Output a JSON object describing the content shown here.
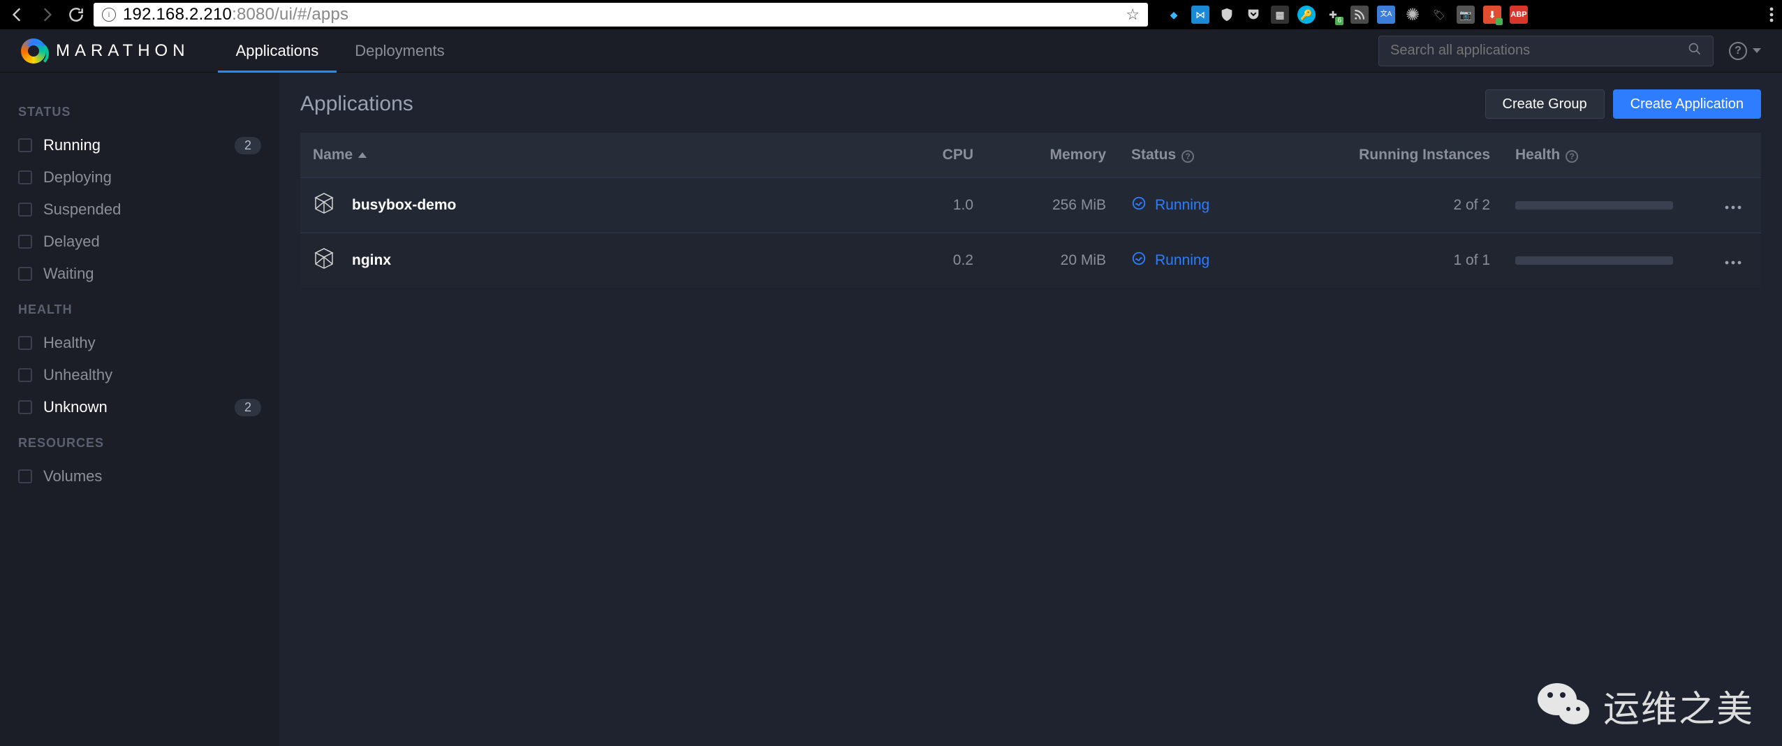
{
  "browser": {
    "url_prefix": "192.168.2.210",
    "url_suffix": ":8080/ui/#/apps",
    "ext_badge": "6",
    "abp_label": "ABP"
  },
  "brand": {
    "name": "MARATHON"
  },
  "nav": {
    "applications": "Applications",
    "deployments": "Deployments"
  },
  "search": {
    "placeholder": "Search all applications"
  },
  "sidebar": {
    "status_title": "STATUS",
    "health_title": "HEALTH",
    "resources_title": "RESOURCES",
    "status_items": [
      {
        "label": "Running",
        "count": "2"
      },
      {
        "label": "Deploying"
      },
      {
        "label": "Suspended"
      },
      {
        "label": "Delayed"
      },
      {
        "label": "Waiting"
      }
    ],
    "health_items": [
      {
        "label": "Healthy"
      },
      {
        "label": "Unhealthy"
      },
      {
        "label": "Unknown",
        "count": "2"
      }
    ],
    "resource_items": [
      {
        "label": "Volumes"
      }
    ]
  },
  "page": {
    "title": "Applications",
    "create_group": "Create Group",
    "create_app": "Create Application"
  },
  "table": {
    "headers": {
      "name": "Name",
      "cpu": "CPU",
      "memory": "Memory",
      "status": "Status",
      "instances": "Running Instances",
      "health": "Health"
    },
    "rows": [
      {
        "name": "busybox-demo",
        "cpu": "1.0",
        "memory": "256 MiB",
        "status": "Running",
        "instances": "2 of 2"
      },
      {
        "name": "nginx",
        "cpu": "0.2",
        "memory": "20 MiB",
        "status": "Running",
        "instances": "1 of 1"
      }
    ]
  },
  "watermark": {
    "text": "运维之美"
  }
}
